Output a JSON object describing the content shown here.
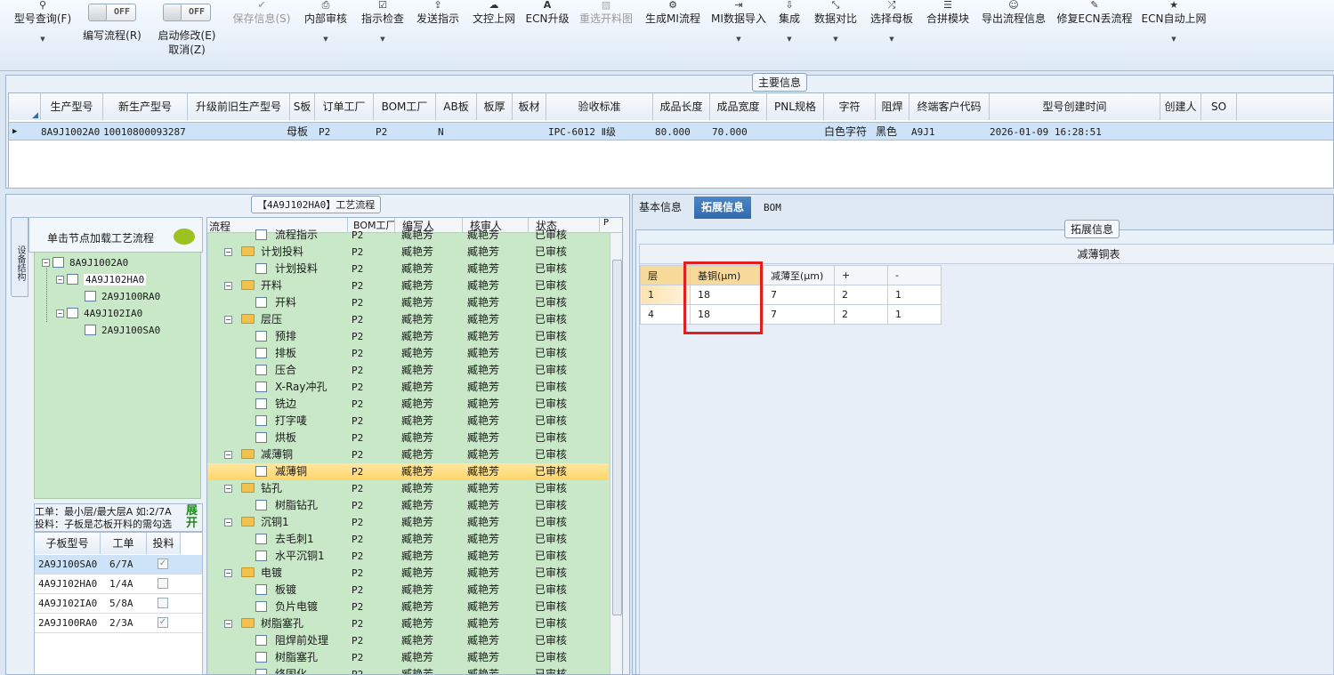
{
  "toolbar": {
    "items": [
      {
        "label": "型号查询(F)",
        "icon": "search-icon"
      },
      {
        "label": "编写流程(R)",
        "toggle": "OFF"
      },
      {
        "label": "启动修改(E)",
        "label2": "取消(Z)",
        "toggle": "OFF"
      },
      {
        "label": "保存信息(S)",
        "icon": "check-icon",
        "disabled": true
      },
      {
        "label": "内部审核",
        "icon": "print-icon"
      },
      {
        "label": "指示检查",
        "icon": "checkbox-icon"
      },
      {
        "label": "发送指示",
        "icon": "upload-icon"
      },
      {
        "label": "文控上网",
        "icon": "cloud-upload-icon"
      },
      {
        "label": "ECN升级",
        "icon": "letter-a-icon"
      },
      {
        "label": "重选开料图",
        "icon": "image-icon",
        "disabled": true
      },
      {
        "label": "生成MI流程",
        "icon": "gears-icon"
      },
      {
        "label": "MI数据导入",
        "icon": "import-icon"
      },
      {
        "label": "集成",
        "icon": "download-icon"
      },
      {
        "label": "数据对比",
        "icon": "compare-icon"
      },
      {
        "label": "选择母板",
        "icon": "shuffle-icon"
      },
      {
        "label": "合拼模块",
        "icon": "list-icon"
      },
      {
        "label": "导出流程信息",
        "icon": "smile-icon"
      },
      {
        "label": "修复ECN丢流程",
        "icon": "wrench-icon"
      },
      {
        "label": "ECN自动上网",
        "icon": "star-icon"
      }
    ]
  },
  "main_info": {
    "caption": "主要信息",
    "columns": [
      "生产型号",
      "新生产型号",
      "升级前旧生产型号",
      "S板",
      "订单工厂",
      "BOM工厂",
      "AB板",
      "板厚",
      "板材",
      "验收标准",
      "成品长度",
      "成品宽度",
      "PNL规格",
      "字符",
      "阻焊",
      "终端客户代码",
      "型号创建时间",
      "创建人",
      "SO"
    ],
    "row": [
      "8A9J1002A0",
      "10010800093287",
      "",
      "母板",
      "P2",
      "P2",
      "N",
      "",
      "",
      "IPC-6012 Ⅱ级",
      "80.000",
      "70.000",
      "",
      "白色字符",
      "黑色",
      "A9J1",
      "2026-01-09 16:28:51",
      "",
      ""
    ]
  },
  "process": {
    "caption": "【4A9J102HA0】工艺流程",
    "side_tab": "设备结构",
    "load_hint": "单击节点加载工艺流程",
    "tree": [
      {
        "label": "8A9J1002A0"
      },
      {
        "label": "4A9J102HA0"
      },
      {
        "label": "2A9J100RA0"
      },
      {
        "label": "4A9J102IA0"
      },
      {
        "label": "2A9J100SA0"
      }
    ],
    "note1": "工单：最小层/最大层A 如:2/7A",
    "note2": "投料：子板是芯板开料的需勾选",
    "expand": "展开",
    "sub_columns": [
      "子板型号",
      "工单",
      "投料"
    ],
    "sub_rows": [
      {
        "model": "2A9J100SA0",
        "order": "6/7A",
        "feed": true
      },
      {
        "model": "4A9J102HA0",
        "order": "1/4A",
        "feed": false
      },
      {
        "model": "4A9J102IA0",
        "order": "5/8A",
        "feed": false
      },
      {
        "model": "2A9J100RA0",
        "order": "2/3A",
        "feed": true
      }
    ],
    "flow_columns": [
      "流程",
      "BOM工厂",
      "编写人",
      "核审人",
      "状态",
      "P"
    ],
    "flow_rows": [
      {
        "name": "流程指示",
        "level": 2,
        "folder": false
      },
      {
        "name": "计划投料",
        "level": 1,
        "folder": true
      },
      {
        "name": "计划投料",
        "level": 2,
        "folder": false
      },
      {
        "name": "开料",
        "level": 1,
        "folder": true
      },
      {
        "name": "开料",
        "level": 2,
        "folder": false
      },
      {
        "name": "层压",
        "level": 1,
        "folder": true
      },
      {
        "name": "预排",
        "level": 2,
        "folder": false
      },
      {
        "name": "排板",
        "level": 2,
        "folder": false
      },
      {
        "name": "压合",
        "level": 2,
        "folder": false
      },
      {
        "name": "X-Ray冲孔",
        "level": 2,
        "folder": false
      },
      {
        "name": "铣边",
        "level": 2,
        "folder": false
      },
      {
        "name": "打字唛",
        "level": 2,
        "folder": false
      },
      {
        "name": "烘板",
        "level": 2,
        "folder": false
      },
      {
        "name": "减薄铜",
        "level": 1,
        "folder": true
      },
      {
        "name": "减薄铜",
        "level": 2,
        "folder": false,
        "selected": true
      },
      {
        "name": "钻孔",
        "level": 1,
        "folder": true
      },
      {
        "name": "树脂钻孔",
        "level": 2,
        "folder": false
      },
      {
        "name": "沉铜1",
        "level": 1,
        "folder": true
      },
      {
        "name": "去毛刺1",
        "level": 2,
        "folder": false
      },
      {
        "name": "水平沉铜1",
        "level": 2,
        "folder": false
      },
      {
        "name": "电镀",
        "level": 1,
        "folder": true
      },
      {
        "name": "板镀",
        "level": 2,
        "folder": false
      },
      {
        "name": "负片电镀",
        "level": 2,
        "folder": false
      },
      {
        "name": "树脂塞孔",
        "level": 1,
        "folder": true
      },
      {
        "name": "阻焊前处理",
        "level": 2,
        "folder": false
      },
      {
        "name": "树脂塞孔",
        "level": 2,
        "folder": false
      },
      {
        "name": "终固化",
        "level": 2,
        "folder": false
      }
    ],
    "factory": "P2",
    "writer": "臧艳芳",
    "reviewer": "臧艳芳",
    "status": "已审核"
  },
  "right": {
    "tabs": [
      "基本信息",
      "拓展信息",
      "BOM"
    ],
    "active_tab": 1,
    "caption": "拓展信息",
    "table_title": "减薄铜表",
    "columns": [
      "层",
      "基铜(μm)",
      "减薄至(μm)",
      "+",
      "-"
    ],
    "rows": [
      [
        "1",
        "18",
        "7",
        "2",
        "1"
      ],
      [
        "4",
        "18",
        "7",
        "2",
        "1"
      ]
    ]
  }
}
